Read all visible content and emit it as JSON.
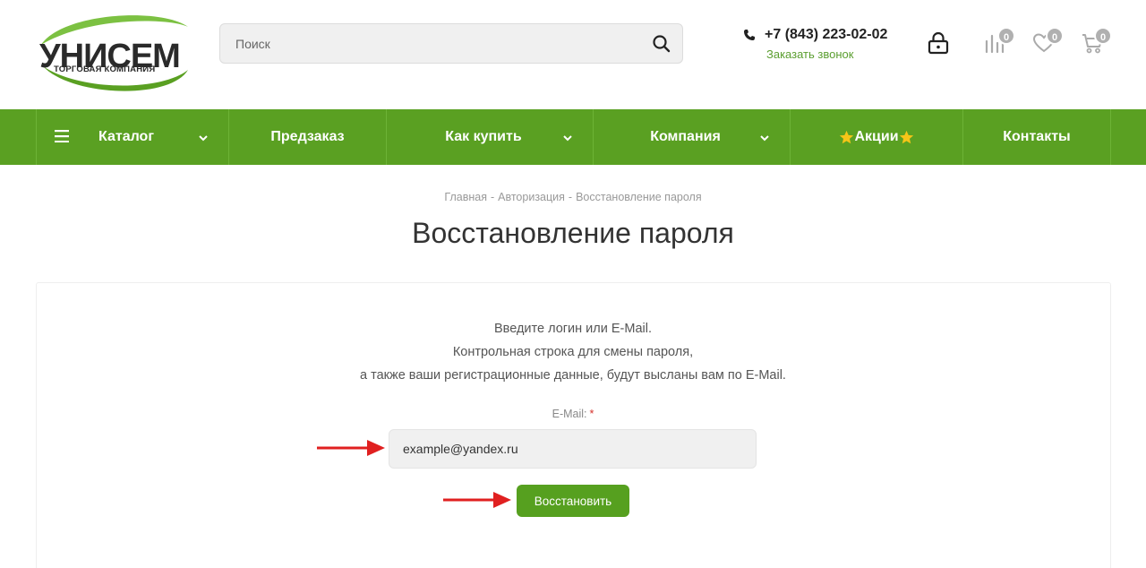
{
  "logo": {
    "brand": "УНИСЕМ",
    "tagline": "ТОРГОВАЯ КОМПАНИЯ",
    "accent_color": "#7cc142"
  },
  "search": {
    "placeholder": "Поиск",
    "icon": "search-icon"
  },
  "contact": {
    "phone": "+7 (843) 223-02-02",
    "callback_label": "Заказать звонок",
    "icon": "phone-icon"
  },
  "header_icons": [
    {
      "icon": "lock-icon"
    },
    {
      "icon": "compare-icon",
      "count": "0"
    },
    {
      "icon": "heart-icon",
      "count": "0"
    },
    {
      "icon": "cart-icon",
      "count": "0"
    }
  ],
  "nav": {
    "color": "#5aa022",
    "items": [
      {
        "label": "Каталог",
        "has_menu": true,
        "icon": "burger-icon"
      },
      {
        "label": "Предзаказ",
        "has_menu": false
      },
      {
        "label": "Как купить",
        "has_menu": true
      },
      {
        "label": "Компания",
        "has_menu": true
      },
      {
        "label": "Акции",
        "has_menu": false,
        "icon": "star-icon"
      },
      {
        "label": "Контакты",
        "has_menu": false
      }
    ]
  },
  "breadcrumb": {
    "items": [
      "Главная",
      "Авторизация",
      "Восстановление пароля"
    ],
    "separator": "-"
  },
  "page": {
    "title": "Восстановление пароля",
    "intro_lines": [
      "Введите логин или E-Mail.",
      "Контрольная строка для смены пароля,",
      "а также ваши регистрационные данные, будут высланы вам по E-Mail."
    ]
  },
  "form": {
    "email_label": "E-Mail:",
    "required_mark": "*",
    "email_value": "example@yandex.ru",
    "submit_label": "Восстановить",
    "button_color": "#56a01f"
  },
  "annotations": {
    "arrow_color": "#e02020"
  }
}
